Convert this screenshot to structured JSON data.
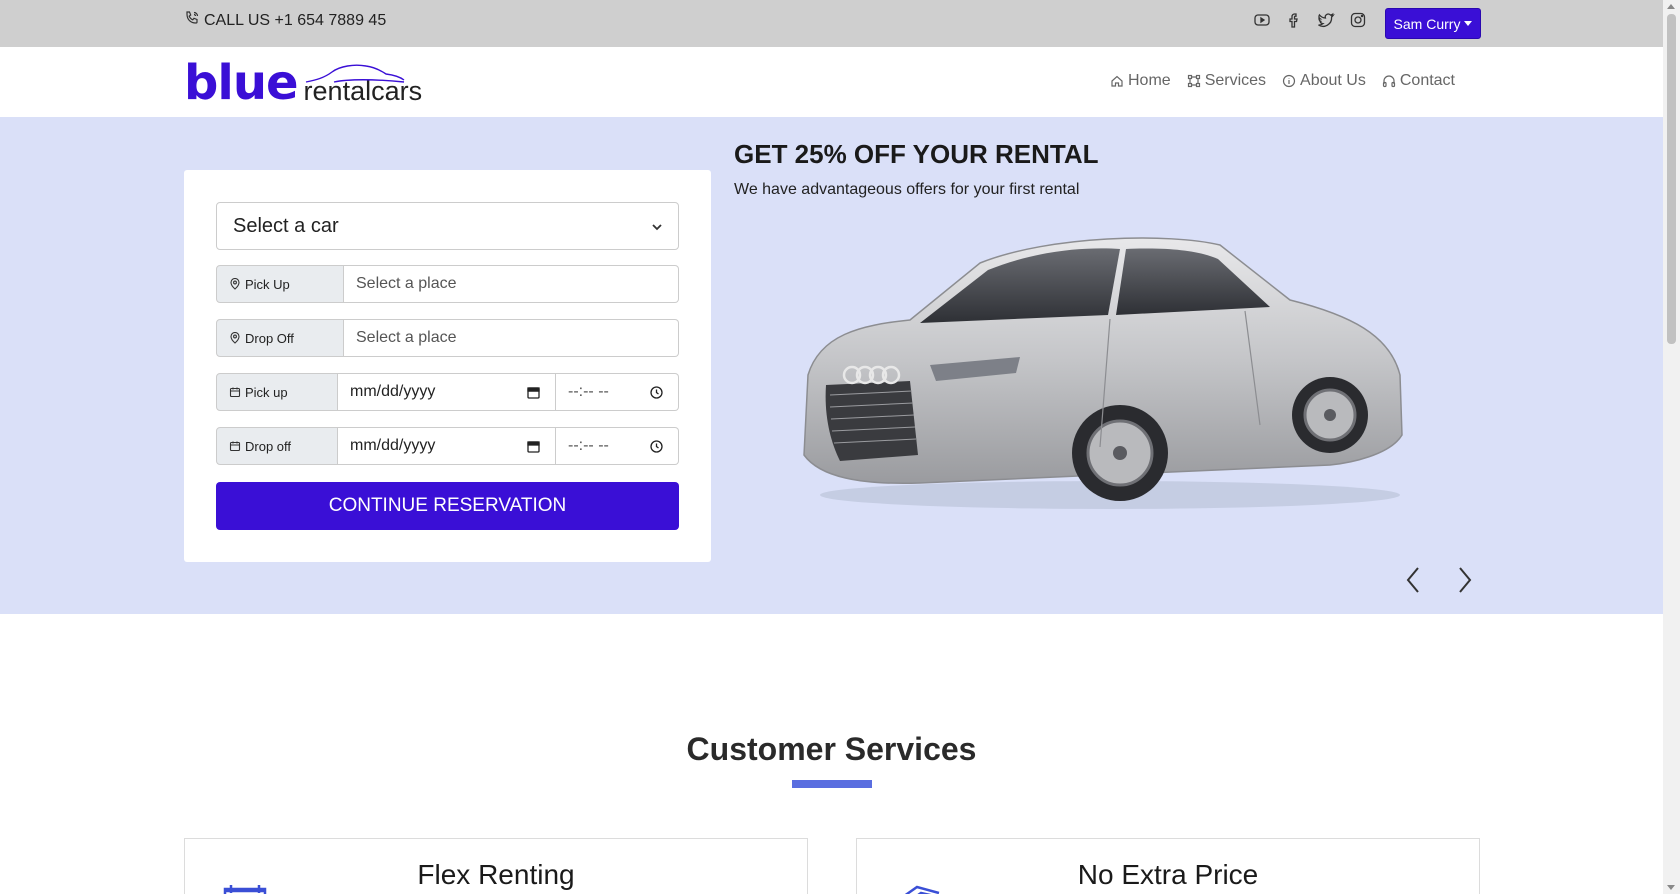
{
  "topbar": {
    "call_text": "CALL US +1 654 7889 45",
    "socials": [
      "youtube-icon",
      "facebook-icon",
      "twitter-icon",
      "instagram-icon"
    ],
    "user_name": "Sam Curry"
  },
  "navbar": {
    "logo_primary": "blue",
    "logo_secondary": "rentalcars",
    "items": [
      {
        "label": "Home",
        "icon": "home-icon"
      },
      {
        "label": "Services",
        "icon": "services-icon"
      },
      {
        "label": "About Us",
        "icon": "info-icon"
      },
      {
        "label": "Contact",
        "icon": "headphones-icon"
      }
    ]
  },
  "booking": {
    "car_select": "Select a car",
    "pickup_place_label": "Pick Up",
    "pickup_place_placeholder": "Select a place",
    "dropoff_place_label": "Drop Off",
    "dropoff_place_placeholder": "Select a place",
    "pickup_date_label": "Pick up",
    "dropoff_date_label": "Drop off",
    "date_placeholder": "mm/dd/yyyy",
    "time_placeholder": "--:-- --",
    "continue_label": "CONTINUE RESERVATION"
  },
  "promo": {
    "title": "GET 25% OFF YOUR RENTAL",
    "subtitle": "We have advantageous offers for your first rental"
  },
  "services": {
    "title": "Customer Services",
    "cards": [
      {
        "title": "Flex Renting"
      },
      {
        "title": "No Extra Price"
      }
    ]
  },
  "colors": {
    "brand": "#3a0fd6",
    "hero_bg": "#dae0f8",
    "topbar_bg": "#cfcfcf",
    "accent": "#5a6ee0"
  }
}
